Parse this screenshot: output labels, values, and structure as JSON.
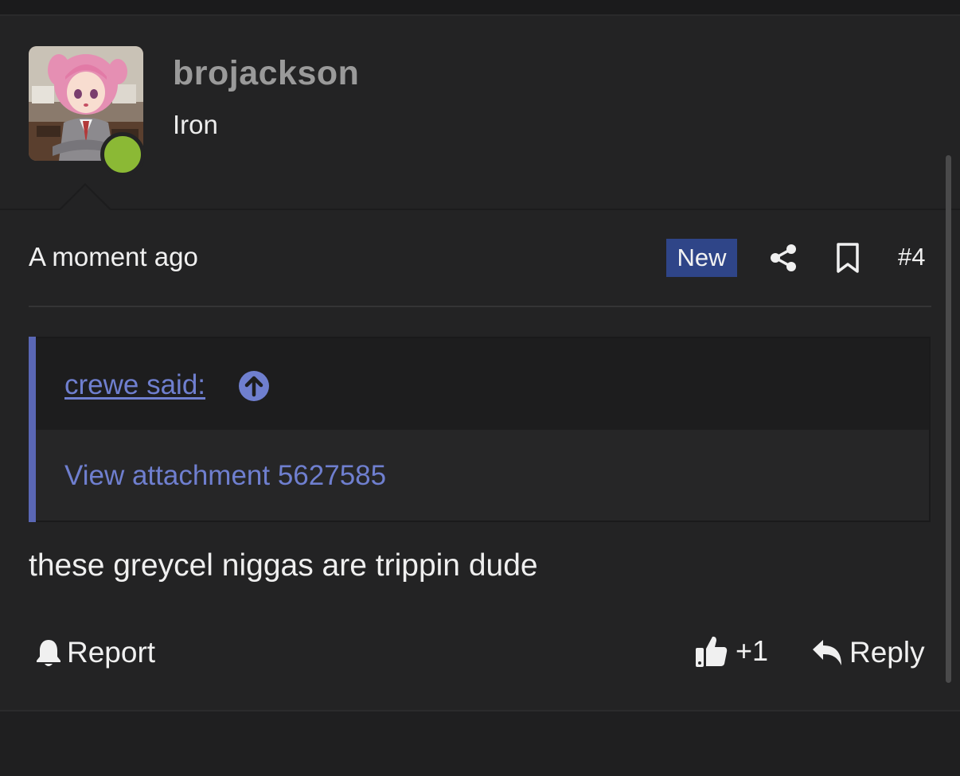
{
  "user": {
    "username": "brojackson",
    "title": "Iron",
    "online": true,
    "avatar_icon": "anime-girl-avatar"
  },
  "meta": {
    "timestamp": "A moment ago",
    "new_badge": "New",
    "post_number": "#4",
    "share_icon": "share-icon",
    "bookmark_icon": "bookmark-icon"
  },
  "quote": {
    "author_link": "crewe said:",
    "body": "View attachment 5627585",
    "accent_color": "#5a67b5"
  },
  "message": {
    "text": "these greycel niggas are trippin dude"
  },
  "actions": {
    "report_label": "Report",
    "like_count": "+1",
    "reply_label": "Reply"
  },
  "colors": {
    "background": "#232324",
    "badge": "#2f4588",
    "online": "#8bb935",
    "link": "#6f7fcf"
  }
}
